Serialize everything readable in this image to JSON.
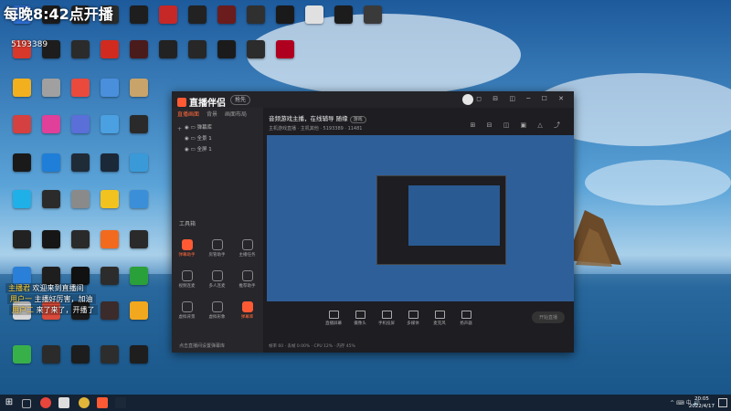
{
  "overlay": {
    "title": "每晚8:42点开播",
    "room_id": "5193389"
  },
  "desktop_icons": [
    {
      "label": "",
      "color": "#2e6fd4"
    },
    {
      "label": "",
      "color": "#1b1b1b"
    },
    {
      "label": "",
      "color": "#1f1f1f"
    },
    {
      "label": "",
      "color": "#2a2a2a"
    },
    {
      "label": "",
      "color": "#1e1e1e"
    },
    {
      "label": "",
      "color": "#c62828"
    },
    {
      "label": "",
      "color": "#222"
    },
    {
      "label": "",
      "color": "#6b1c1c"
    },
    {
      "label": "",
      "color": "#303030"
    },
    {
      "label": "",
      "color": "#1a1a1a"
    },
    {
      "label": "",
      "color": "#e0e0e0"
    },
    {
      "label": "",
      "color": "#1c1c1c"
    },
    {
      "label": "",
      "color": "#3a3a3a"
    },
    {
      "label": "",
      "color": "#d8382a"
    },
    {
      "label": "",
      "color": "#1d1d1d"
    },
    {
      "label": "",
      "color": "#2b2b2b"
    },
    {
      "label": "",
      "color": "#d12b1f"
    },
    {
      "label": "",
      "color": "#4a1b1b"
    },
    {
      "label": "",
      "color": "#222"
    },
    {
      "label": "",
      "color": "#272727"
    },
    {
      "label": "",
      "color": "#1b1b1b"
    },
    {
      "label": "",
      "color": "#2c2c2c"
    },
    {
      "label": "",
      "color": "#b00020"
    },
    {
      "label": "",
      "color": "#f2b01e"
    },
    {
      "label": "",
      "color": "#a0a0a0"
    },
    {
      "label": "",
      "color": "#e94a3c"
    },
    {
      "label": "",
      "color": "#4a8fdc"
    },
    {
      "label": "",
      "color": "#c8a36a"
    },
    {
      "label": "",
      "color": "#d54040"
    },
    {
      "label": "",
      "color": "#e0409a"
    },
    {
      "label": "",
      "color": "#5a6fd8"
    },
    {
      "label": "",
      "color": "#4aa0e0"
    },
    {
      "label": "",
      "color": "#2a2a2a"
    },
    {
      "label": "",
      "color": "#1a1a1a"
    },
    {
      "label": "",
      "color": "#1f7fd8"
    },
    {
      "label": "",
      "color": "#202b38"
    },
    {
      "label": "",
      "color": "#1b2838"
    },
    {
      "label": "",
      "color": "#3a9ad8"
    },
    {
      "label": "",
      "color": "#1fb0e8"
    },
    {
      "label": "",
      "color": "#2b2b2b"
    },
    {
      "label": "",
      "color": "#8a8a8a"
    },
    {
      "label": "",
      "color": "#f2c21e"
    },
    {
      "label": "",
      "color": "#3a8fd8"
    },
    {
      "label": "",
      "color": "#222"
    },
    {
      "label": "",
      "color": "#161616"
    },
    {
      "label": "",
      "color": "#2a2a2a"
    },
    {
      "label": "",
      "color": "#f26a1e"
    },
    {
      "label": "",
      "color": "#2a2a2a"
    },
    {
      "label": "",
      "color": "#2a7fd8"
    },
    {
      "label": "",
      "color": "#1e1e1e"
    },
    {
      "label": "",
      "color": "#111"
    },
    {
      "label": "",
      "color": "#2c2c2c"
    },
    {
      "label": "",
      "color": "#2aa03a"
    },
    {
      "label": "",
      "color": "#d8d8d8"
    },
    {
      "label": "",
      "color": "#d84a3a"
    },
    {
      "label": "",
      "color": "#1a1a1a"
    },
    {
      "label": "",
      "color": "#3b2b2b"
    },
    {
      "label": "",
      "color": "#f2a81e"
    },
    {
      "label": "",
      "color": "#38b04a"
    },
    {
      "label": "",
      "color": "#2b2b2b"
    },
    {
      "label": "",
      "color": "#1d1d1d"
    },
    {
      "label": "",
      "color": "#2d2d2d"
    },
    {
      "label": "",
      "color": "#1e1e1e"
    },
    {
      "label": "",
      "color": "#d8241e"
    },
    {
      "label": "",
      "color": "#e8e8e8"
    },
    {
      "label": "",
      "color": "#1e6fd8"
    },
    {
      "label": "",
      "color": "#2a2a2a"
    },
    {
      "label": "",
      "color": "#8a1b1b"
    },
    {
      "label": "",
      "color": "#3a3a3a"
    },
    {
      "label": "",
      "color": "#222"
    },
    {
      "label": "",
      "color": "#202020"
    },
    {
      "label": "",
      "color": "#2b2b2b"
    }
  ],
  "app": {
    "logo_text": "直播伴侣",
    "version_tag": "抢先",
    "window_buttons": "◻ ⊟ ◫ ─ ☐ ✕",
    "side_tabs": [
      "直播画面",
      "背景",
      "画面布局",
      "+"
    ],
    "scenes": [
      "弹幕库",
      "全景 1",
      "全屏 1"
    ],
    "tools_title": "工具箱",
    "tools": [
      {
        "label": "弹幕助手",
        "hot": true
      },
      {
        "label": "房管助手",
        "hot": false
      },
      {
        "label": "主播任务",
        "hot": false
      },
      {
        "label": "视频连麦",
        "hot": false
      },
      {
        "label": "多人连麦",
        "hot": false
      },
      {
        "label": "推荐助手",
        "hot": false
      },
      {
        "label": "虚拟背景",
        "hot": false
      },
      {
        "label": "虚拟形象",
        "hot": false
      },
      {
        "label": "弹幕库",
        "hot": true
      }
    ],
    "side_footer": "点击直播间设置弹幕库",
    "main_title": "音频游戏主播，在线辅导 随缘",
    "main_tag": "游戏",
    "main_sub": "主机游戏直播 · 主机其他 · 5193389 · 11481",
    "main_icons": "⊞ ⊟ ◫ ▣ △ ⤴",
    "bottom_buttons": [
      "直播屏幕",
      "摄像头",
      "手机投屏",
      "多媒体",
      "麦克风",
      "扬声器"
    ],
    "start_live": "开始直播",
    "footer_stats": "帧率 60 · 丢帧 0.00% · CPU 12% · 内存 45%"
  },
  "danmaku": [
    {
      "name": "主播君",
      "text": "欢迎来到直播间"
    },
    {
      "name": "用户一",
      "text": "主播好厉害，加油"
    },
    {
      "name": "用户二",
      "text": "来了来了，开播了"
    }
  ],
  "taskbar": {
    "start": "⊞",
    "tray": "^ ⌨ 中 🔊",
    "time": "20:05",
    "date": "2022/4/17"
  }
}
